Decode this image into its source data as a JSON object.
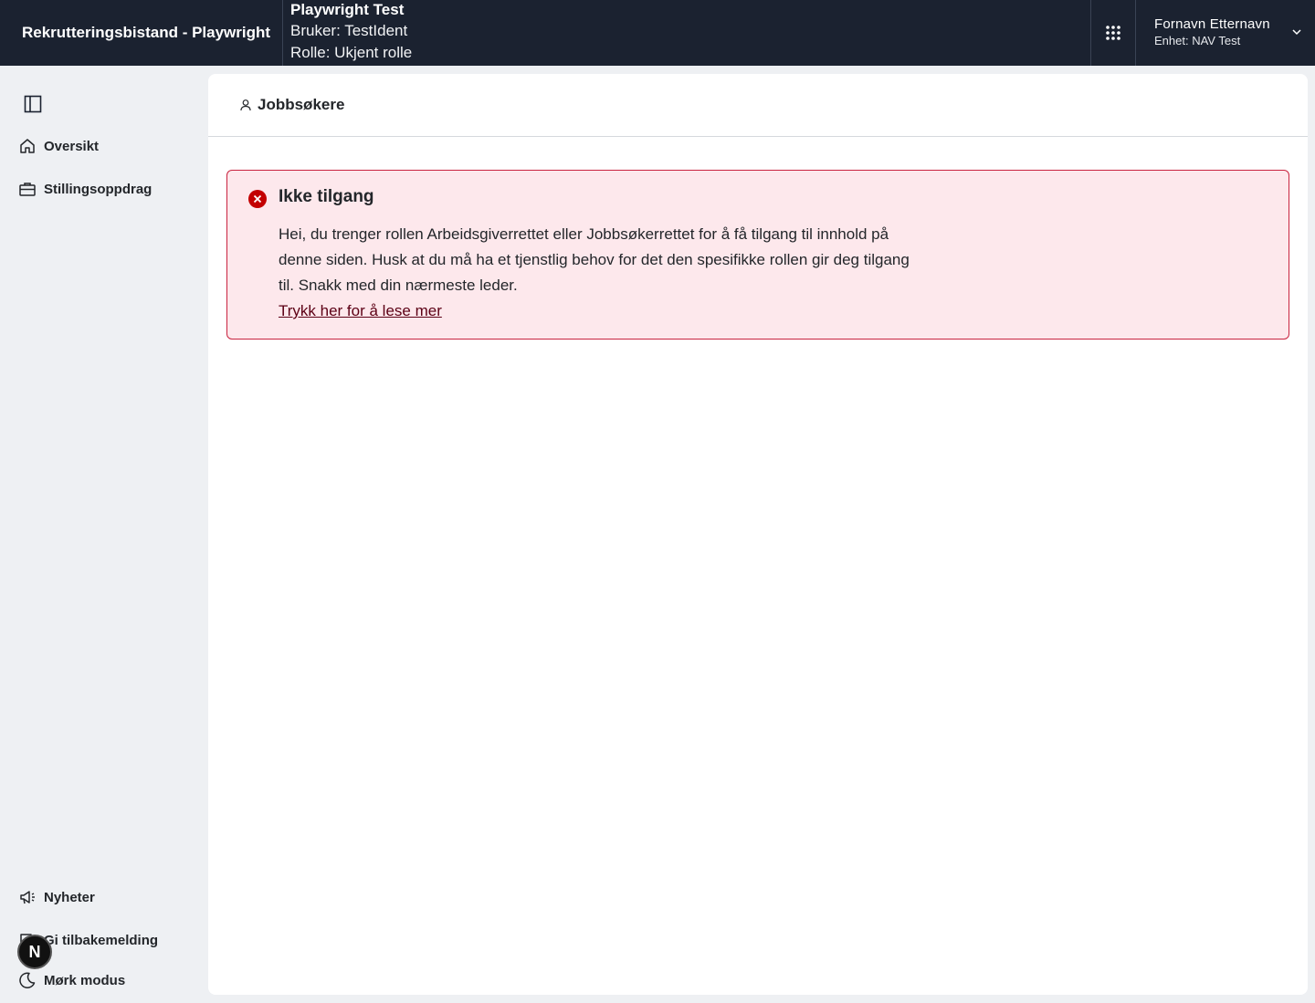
{
  "header": {
    "app_title": "Rekrutteringsbistand - Playwright",
    "env_title": "Playwright Test",
    "env_user": "Bruker: TestIdent",
    "env_role": "Rolle: Ukjent rolle",
    "user_name": "Fornavn Etternavn",
    "user_unit": "Enhet: NAV Test"
  },
  "sidebar": {
    "items": [
      {
        "label": "Oversikt",
        "icon": "home-icon"
      },
      {
        "label": "Stillingsoppdrag",
        "icon": "briefcase-icon"
      }
    ],
    "bottom_items": [
      {
        "label": "Nyheter",
        "icon": "megaphone-icon"
      },
      {
        "label": "Gi tilbakemelding",
        "icon": "chat-icon"
      },
      {
        "label": "Mørk modus",
        "icon": "moon-icon"
      }
    ],
    "badge_letter": "N"
  },
  "main": {
    "page_title": "Jobbsøkere",
    "alert": {
      "heading": "Ikke tilgang",
      "body": "Hei, du trenger rollen Arbeidsgiverrettet eller Jobbsøkerrettet for å få tilgang til innhold på denne siden. Husk at du må ha et tjenstlig behov for det den spesifikke rollen gir deg tilgang til. Snakk med din nærmeste leder.",
      "link": "Trykk her for å lese mer"
    }
  },
  "colors": {
    "header_bg": "#1b2230",
    "sidebar_bg": "#eef0f3",
    "alert_bg": "#fde8ec",
    "alert_border": "#c9233f",
    "alert_icon": "#c30000"
  }
}
